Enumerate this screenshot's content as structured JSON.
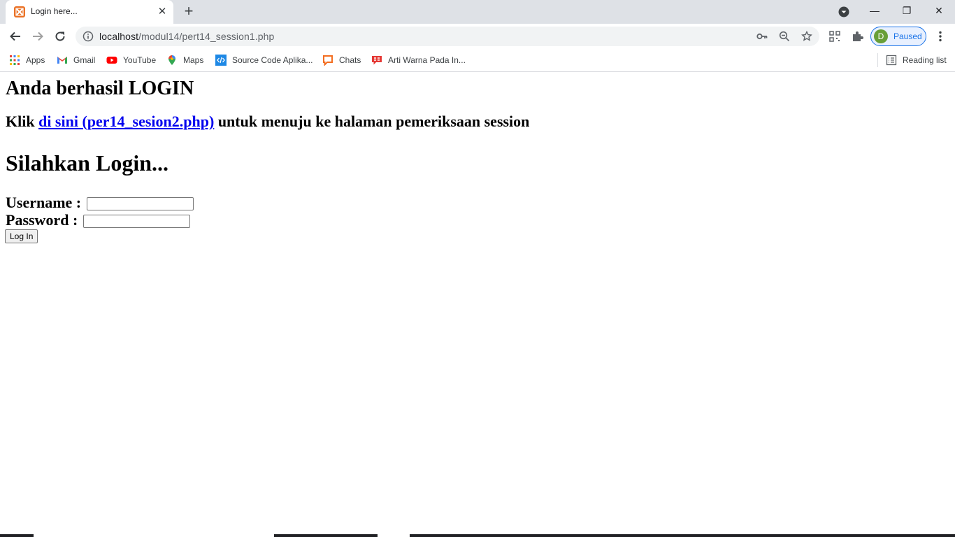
{
  "browser": {
    "tab": {
      "title": "Login here...",
      "close_glyph": "✕"
    },
    "new_tab_glyph": "+",
    "window_controls": {
      "minimize": "—",
      "restore": "❐",
      "close": "✕"
    },
    "address": {
      "host": "localhost",
      "path": "/modul14/pert14_session1.php"
    },
    "profile": {
      "initial": "D",
      "status": "Paused",
      "avatar_color": "#689f38",
      "accent": "#1a73e8"
    },
    "bookmarks": [
      {
        "label": "Apps",
        "icon": "apps-grid-icon"
      },
      {
        "label": "Gmail",
        "icon": "gmail-icon"
      },
      {
        "label": "YouTube",
        "icon": "youtube-icon"
      },
      {
        "label": "Maps",
        "icon": "maps-icon"
      },
      {
        "label": "Source Code Aplika...",
        "icon": "code-icon"
      },
      {
        "label": "Chats",
        "icon": "chat-icon"
      },
      {
        "label": "Arti Warna Pada In...",
        "icon": "bookmark-site-icon"
      }
    ],
    "reading_list": "Reading list"
  },
  "page": {
    "success_heading": "Anda berhasil LOGIN",
    "klik_prefix": "Klik ",
    "link_text": "di sini (per14_sesion2.php)",
    "klik_suffix": " untuk menuju ke halaman pemeriksaan session",
    "login_heading": "Silahkan Login...",
    "username_label": "Username : ",
    "username_value": "",
    "password_label": "Password : ",
    "password_value": "",
    "login_button": "Log In",
    "link_color": "#0000ee"
  }
}
